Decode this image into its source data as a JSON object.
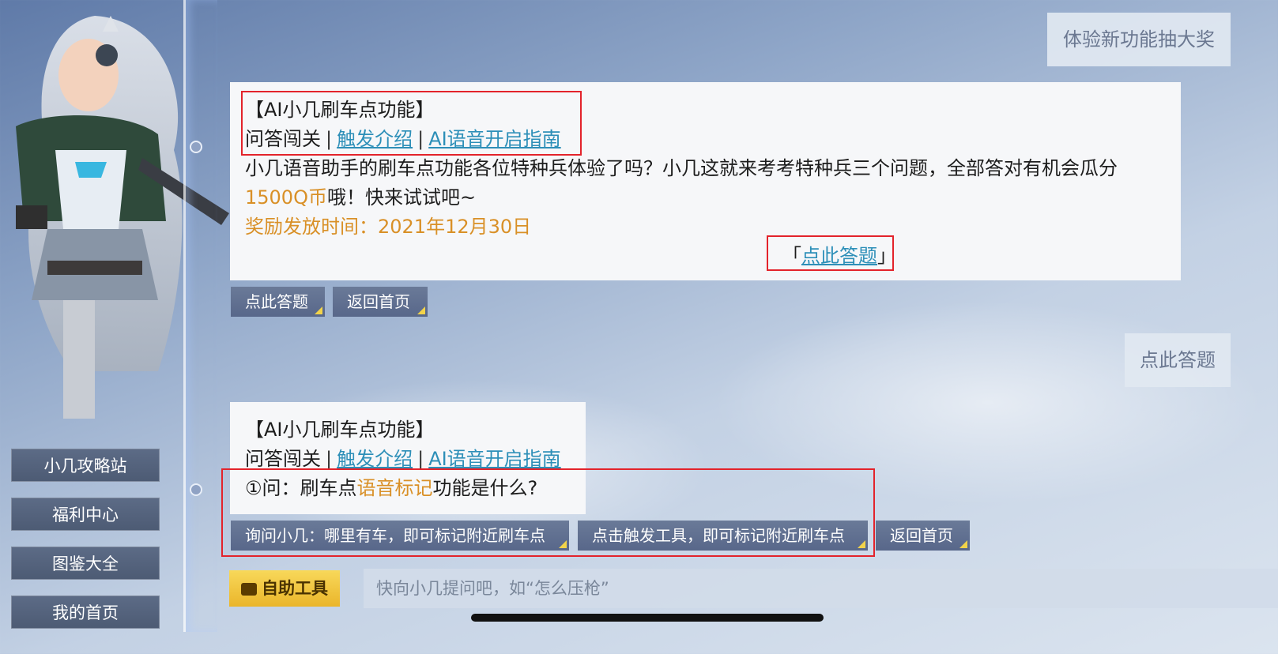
{
  "top_right_banner": "体验新功能抽大奖",
  "message1": {
    "title": "【AI小几刷车点功能】",
    "nav_qa": "问答闯关",
    "nav_sep": "|",
    "nav_trigger": "触发介绍",
    "nav_voice": "AI语音开启指南",
    "body_line1": "小几语音助手的刷车点功能各位特种兵体验了吗？小几这就来考考特种兵三个问题，全部答对有机会瓜分",
    "body_coins": "1500Q币",
    "body_line2_rest": "哦！快来试试吧~",
    "reward_time": "奖励发放时间：2021年12月30日",
    "answer_link_open": "「",
    "answer_link": "点此答题",
    "answer_link_close": "」"
  },
  "chips1": [
    "点此答题",
    "返回首页"
  ],
  "user_reply": "点此答题",
  "message2": {
    "title": "【AI小几刷车点功能】",
    "nav_qa": "问答闯关",
    "nav_sep": "|",
    "nav_trigger": "触发介绍",
    "nav_voice": "AI语音开启指南",
    "question_prefix": "①问：刷车点",
    "question_highlight": "语音标记",
    "question_suffix": "功能是什么?"
  },
  "chips2": [
    "询问小几：哪里有车，即可标记附近刷车点",
    "点击触发工具，即可标记附近刷车点",
    "返回首页"
  ],
  "side_menu": [
    "小几攻略站",
    "福利中心",
    "图鉴大全",
    "我的首页"
  ],
  "tool_button": "自助工具",
  "input_placeholder": "快向小几提问吧，如“怎么压枪”",
  "colors": {
    "link": "#2d8fb8",
    "highlight": "#d99027",
    "annotation_box": "#e3232b",
    "chip_corner": "#f2d34a"
  }
}
